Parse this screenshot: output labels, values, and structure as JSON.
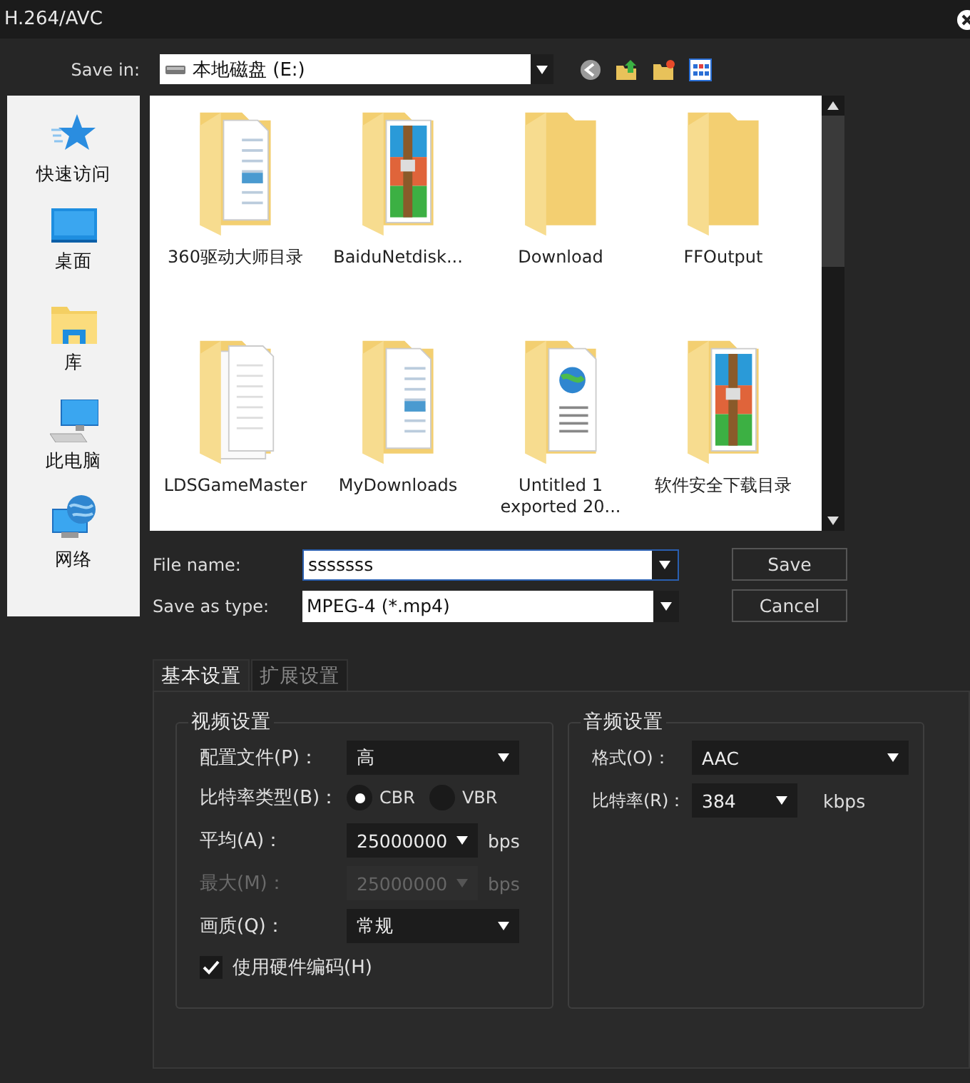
{
  "window": {
    "title": "H.264/AVC"
  },
  "save_in": {
    "label": "Save in:",
    "value": "本地磁盘 (E:)"
  },
  "places": [
    {
      "label": "快速访问",
      "kind": "star"
    },
    {
      "label": "桌面",
      "kind": "desktop"
    },
    {
      "label": "库",
      "kind": "library"
    },
    {
      "label": "此电脑",
      "kind": "computer"
    },
    {
      "label": "网络",
      "kind": "network"
    }
  ],
  "files": [
    {
      "name": "360驱动大师目录",
      "kind": "documents"
    },
    {
      "name": "BaiduNetdisk...",
      "kind": "archive"
    },
    {
      "name": "Download",
      "kind": "plain"
    },
    {
      "name": "FFOutput",
      "kind": "plain"
    },
    {
      "name": "LDSGameMaster",
      "kind": "papers"
    },
    {
      "name": "MyDownloads",
      "kind": "documents"
    },
    {
      "name": "Untitled 1 exported 20...",
      "kind": "web"
    },
    {
      "name": "软件安全下载目录",
      "kind": "archive"
    }
  ],
  "file_name": {
    "label": "File name:",
    "value": "sssssss"
  },
  "save_as_type": {
    "label": "Save as type:",
    "value": "MPEG-4 (*.mp4)"
  },
  "buttons": [
    "Save",
    "Cancel"
  ],
  "tabs": [
    {
      "label": "基本设置",
      "selected": true
    },
    {
      "label": "扩展设置",
      "selected": false
    }
  ],
  "video": {
    "title": "视频设置",
    "rows": [
      {
        "kind": "select",
        "label": "配置文件(P)：",
        "value": "高",
        "disabled": false
      },
      {
        "kind": "radio",
        "label": "比特率类型(B)：",
        "options": [
          {
            "label": "CBR",
            "selected": true
          },
          {
            "label": "VBR",
            "selected": false
          }
        ]
      },
      {
        "kind": "select_unit",
        "label": "平均(A)：",
        "value": "25000000",
        "unit": "bps",
        "disabled": false
      },
      {
        "kind": "select_unit",
        "label": "最大(M)：",
        "value": "25000000",
        "unit": "bps",
        "disabled": true
      },
      {
        "kind": "select",
        "label": "画质(Q)：",
        "value": "常规",
        "disabled": false
      },
      {
        "kind": "checkbox",
        "label": "使用硬件编码(H)",
        "checked": true
      }
    ]
  },
  "audio": {
    "title": "音频设置",
    "rows": [
      {
        "kind": "select",
        "label": "格式(O)：",
        "value": "AAC",
        "disabled": false
      },
      {
        "kind": "select_unit",
        "label": "比特率(R)：",
        "value": "384",
        "unit": "kbps",
        "disabled": false
      }
    ]
  }
}
